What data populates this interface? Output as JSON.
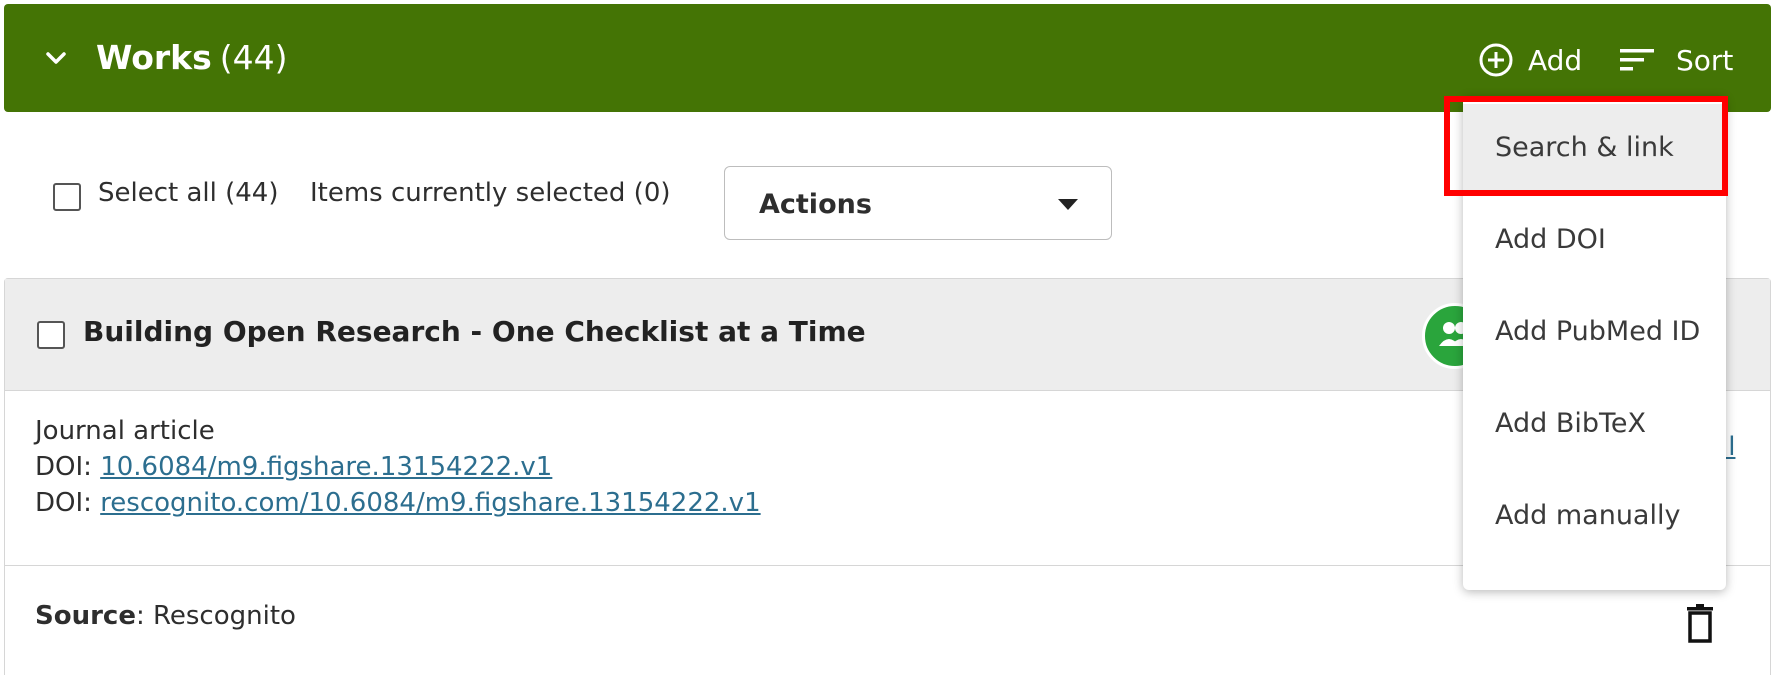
{
  "header": {
    "title": "Works",
    "count": "(44)",
    "add_label": "Add",
    "sort_label": "Sort",
    "color": "#447405"
  },
  "toolbar": {
    "select_all_label": "Select all (44)",
    "selected_label": "Items currently selected (0)",
    "actions_label": "Actions"
  },
  "work": {
    "title": "Building Open Research - One Checklist at a Time",
    "type": "Journal article",
    "doi_prefix_1": "DOI:",
    "doi_1": "10.6084/m9.figshare.13154222.v1",
    "doi_prefix_2": "DOI:",
    "doi_2": "rescognito.com/10.6084/m9.figshare.13154222.v1",
    "detail_link_partial": "il",
    "source_label": "Source",
    "source_value": ": Rescognito"
  },
  "add_menu": {
    "items": [
      {
        "label": "Search & link",
        "highlighted": true
      },
      {
        "label": "Add DOI"
      },
      {
        "label": "Add PubMed ID"
      },
      {
        "label": "Add BibTeX"
      },
      {
        "label": "Add manually"
      }
    ],
    "highlight_color": "#ff0000"
  },
  "icons": {
    "collapse": "chevron-down-icon",
    "add": "plus-circle-icon",
    "sort": "sort-icon",
    "actions": "caret-down-icon",
    "avatar": "group-icon",
    "delete": "trash-icon"
  }
}
